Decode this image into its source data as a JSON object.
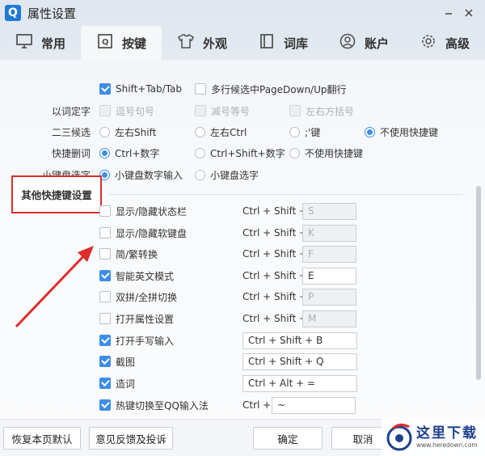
{
  "window": {
    "logo": "Q",
    "title": "属性设置",
    "min_icon": "minimize-icon",
    "close_icon": "close-icon"
  },
  "tabs": [
    {
      "label": "常用",
      "icon": "monitor-icon"
    },
    {
      "label": "按键",
      "icon": "keyboard-icon",
      "active": true
    },
    {
      "label": "外观",
      "icon": "tshirt-icon"
    },
    {
      "label": "词库",
      "icon": "book-icon"
    },
    {
      "label": "账户",
      "icon": "user-icon"
    },
    {
      "label": "高级",
      "icon": "gear-icon"
    }
  ],
  "top_options": {
    "shift_tab": "Shift+Tab/Tab",
    "pagedown": "多行候选中PageDown/Up翻行"
  },
  "rows": {
    "fix_word": {
      "label": "以词定字",
      "opt1": "逗号句号",
      "opt2": "减号等号",
      "opt3": "左右方括号"
    },
    "second_third": {
      "label": "二三候选",
      "opt1": "左右Shift",
      "opt2": "左右Ctrl",
      "opt3": ";'键",
      "opt4": "不使用快捷键"
    },
    "delete_word": {
      "label": "快捷删词",
      "opt1": "Ctrl+数字",
      "opt2": "Ctrl+Shift+数字",
      "opt3": "不使用快捷键"
    },
    "small_kb": {
      "label": "小键盘选字",
      "opt1": "小键盘数字输入",
      "opt2": "小键盘选字"
    }
  },
  "section_title": "其他快捷键设置",
  "hotkeys": [
    {
      "label": "显示/隐藏状态栏",
      "mod": "Ctrl + Shift +",
      "key": "S",
      "checked": false
    },
    {
      "label": "显示/隐藏软键盘",
      "mod": "Ctrl + Shift +",
      "key": "K",
      "checked": false
    },
    {
      "label": "简/繁转换",
      "mod": "Ctrl + Shift +",
      "key": "F",
      "checked": false
    },
    {
      "label": "智能英文模式",
      "mod": "Ctrl + Shift +",
      "key": "E",
      "checked": true
    },
    {
      "label": "双拼/全拼切换",
      "mod": "Ctrl + Shift +",
      "key": "P",
      "checked": false
    },
    {
      "label": "打开属性设置",
      "mod": "Ctrl + Shift +",
      "key": "M",
      "checked": false
    },
    {
      "label": "打开手写输入",
      "value": "Ctrl + Shift + B",
      "checked": true
    },
    {
      "label": "截图",
      "value": "Ctrl + Shift + Q",
      "checked": true
    },
    {
      "label": "造词",
      "value": "Ctrl + Alt + =",
      "checked": true
    },
    {
      "label": "热键切换至QQ输入法",
      "mod": "Ctrl +",
      "key": "~",
      "checked": true
    }
  ],
  "buttons": {
    "restore": "恢复本页默认",
    "feedback": "意见反馈及投诉",
    "ok": "确定",
    "cancel": "取消"
  },
  "watermark": {
    "text": "这里下载",
    "url": "www.heredown.com"
  },
  "colors": {
    "accent": "#3d8ee8",
    "highlight": "#e02b2b"
  }
}
